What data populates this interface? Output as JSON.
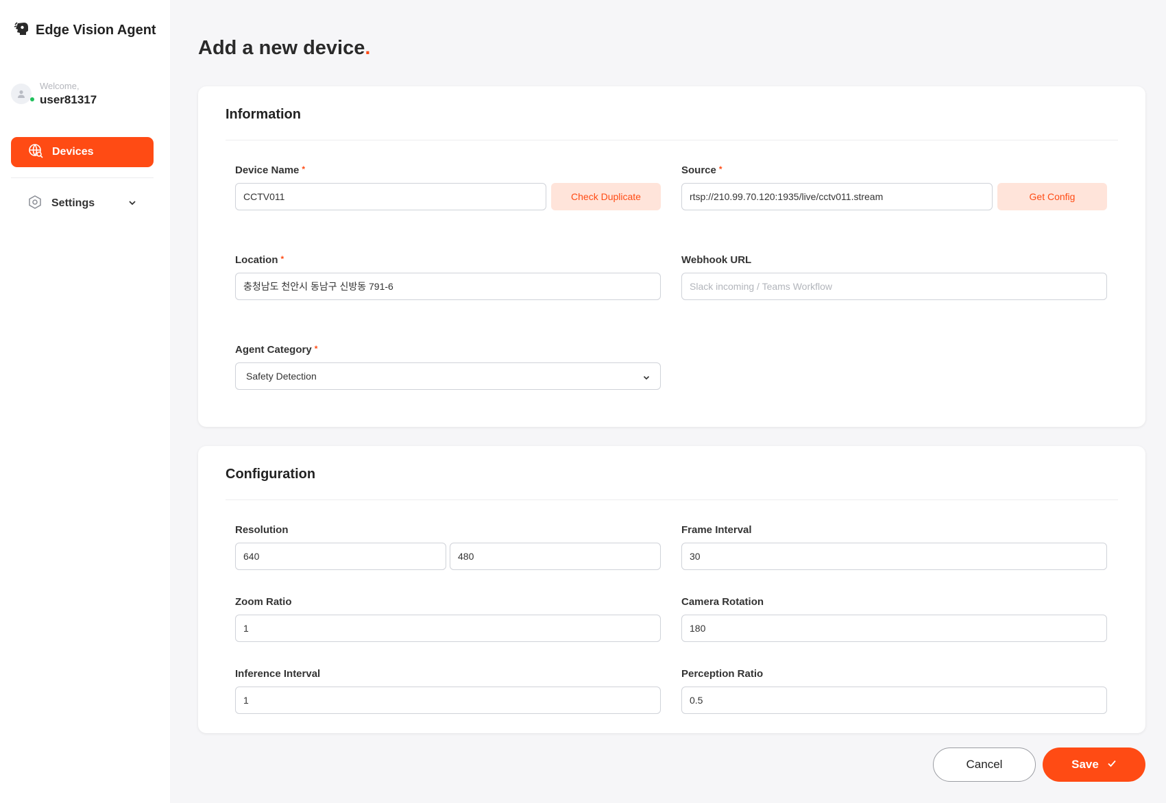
{
  "app": {
    "name": "Edge Vision Agent"
  },
  "user": {
    "welcome": "Welcome,",
    "username": "user81317"
  },
  "nav": {
    "devices": "Devices",
    "settings": "Settings"
  },
  "page": {
    "title": "Add a new device",
    "title_accent": "."
  },
  "information": {
    "title": "Information",
    "device_name": {
      "label": "Device Name",
      "required": "*",
      "value": "CCTV011",
      "button": "Check Duplicate"
    },
    "source": {
      "label": "Source",
      "required": "*",
      "value": "rtsp://210.99.70.120:1935/live/cctv011.stream",
      "button": "Get Config"
    },
    "location": {
      "label": "Location",
      "required": "*",
      "value": "충청남도 천안시 동남구 신방동 791-6"
    },
    "webhook": {
      "label": "Webhook URL",
      "value": "",
      "placeholder": "Slack incoming / Teams Workflow"
    },
    "agent_category": {
      "label": "Agent Category",
      "required": "*",
      "value": "Safety Detection"
    }
  },
  "configuration": {
    "title": "Configuration",
    "resolution": {
      "label": "Resolution",
      "width": "640",
      "height": "480"
    },
    "frame_interval": {
      "label": "Frame Interval",
      "value": "30"
    },
    "zoom_ratio": {
      "label": "Zoom Ratio",
      "value": "1"
    },
    "camera_rotation": {
      "label": "Camera Rotation",
      "value": "180"
    },
    "inference_interval": {
      "label": "Inference Interval",
      "value": "1"
    },
    "perception_ratio": {
      "label": "Perception Ratio",
      "value": "0.5"
    }
  },
  "actions": {
    "cancel": "Cancel",
    "save": "Save"
  },
  "colors": {
    "accent": "#ff4b14",
    "accent_soft": "#ffe4da",
    "online": "#1fbf5b"
  },
  "icons": {
    "brand": "robot-face-icon",
    "devices": "globe-search-icon",
    "settings": "hexagon-gear-icon",
    "save": "check-icon"
  }
}
